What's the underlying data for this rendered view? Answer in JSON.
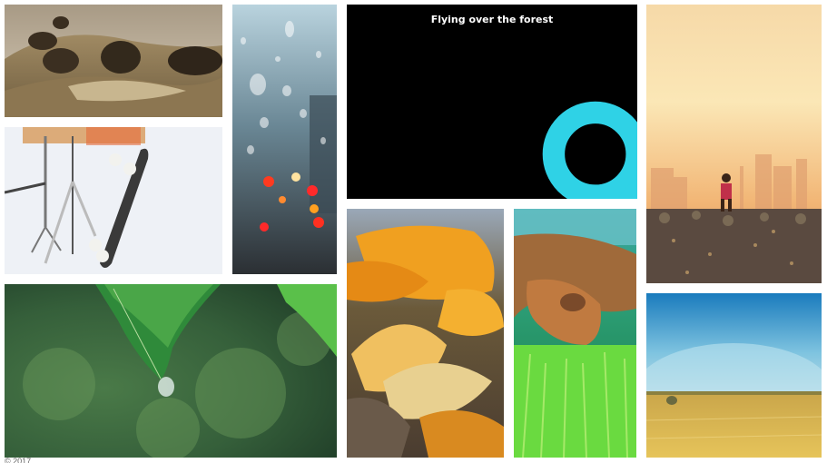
{
  "video": {
    "title": "Flying over the forest"
  },
  "footer": {
    "text": "© 2017"
  },
  "tiles": [
    {
      "name": "photo-sepia-hills"
    },
    {
      "name": "photo-raindrops-window"
    },
    {
      "name": "video-player"
    },
    {
      "name": "photo-sunset-runner"
    },
    {
      "name": "photo-skateboard-tripod"
    },
    {
      "name": "photo-autumn-leaves"
    },
    {
      "name": "photo-dog-grass"
    },
    {
      "name": "photo-leaf-waterdrop"
    },
    {
      "name": "photo-wheat-field"
    }
  ]
}
